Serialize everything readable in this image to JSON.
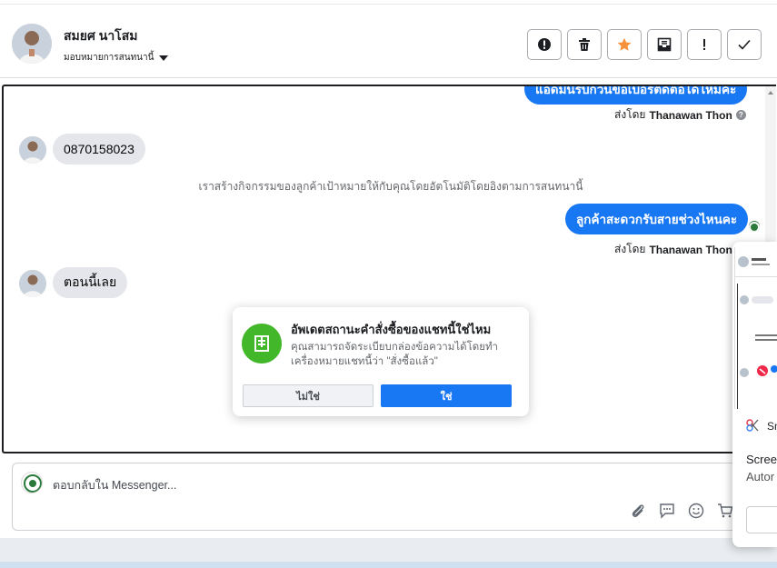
{
  "header": {
    "contact_name": "สมยศ นาโสม",
    "assign_label": "มอบหมายการสนทนานี้"
  },
  "toolbar": {
    "buttons": [
      "report-icon",
      "trash-icon",
      "star-icon",
      "mark-unread-icon",
      "exclamation-icon",
      "check-icon"
    ],
    "star_color": "#f7923a"
  },
  "messages": {
    "out_1_text": "แอดมินรบกวนขอเบอร์ติดต่อได้ไหมคะ",
    "sent_by_prefix": "ส่งโดย",
    "sent_by_name": "Thanawan Thon",
    "in_1_text": "0870158023",
    "system_note": "เราสร้างกิจกรรมของลูกค้าเป้าหมายให้กับคุณโดยอัตโนมัติโดยอิงตามการสนทนานี้",
    "out_2_text": "ลูกค้าสะดวกรับสายช่วงไหนคะ",
    "in_2_text": "ตอนนี้เลย"
  },
  "dialog": {
    "title": "อัพเดตสถานะคำสั่งซื้อของแชทนี้ใช่ไหม",
    "body": "คุณสามารถจัดระเบียบกล่องข้อความได้โดยทำเครื่องหมายแชทนี้ว่า \"สั่งซื้อแล้ว\"",
    "no_label": "ไม่ใช่",
    "yes_label": "ใช่"
  },
  "reply": {
    "placeholder": "ตอบกลับใน Messenger..."
  },
  "snip_panel": {
    "title": "Sn",
    "line1": "Scree",
    "line2": "Autor"
  },
  "colors": {
    "messenger_blue": "#1877f2",
    "dialog_icon_green": "#42b72a"
  }
}
